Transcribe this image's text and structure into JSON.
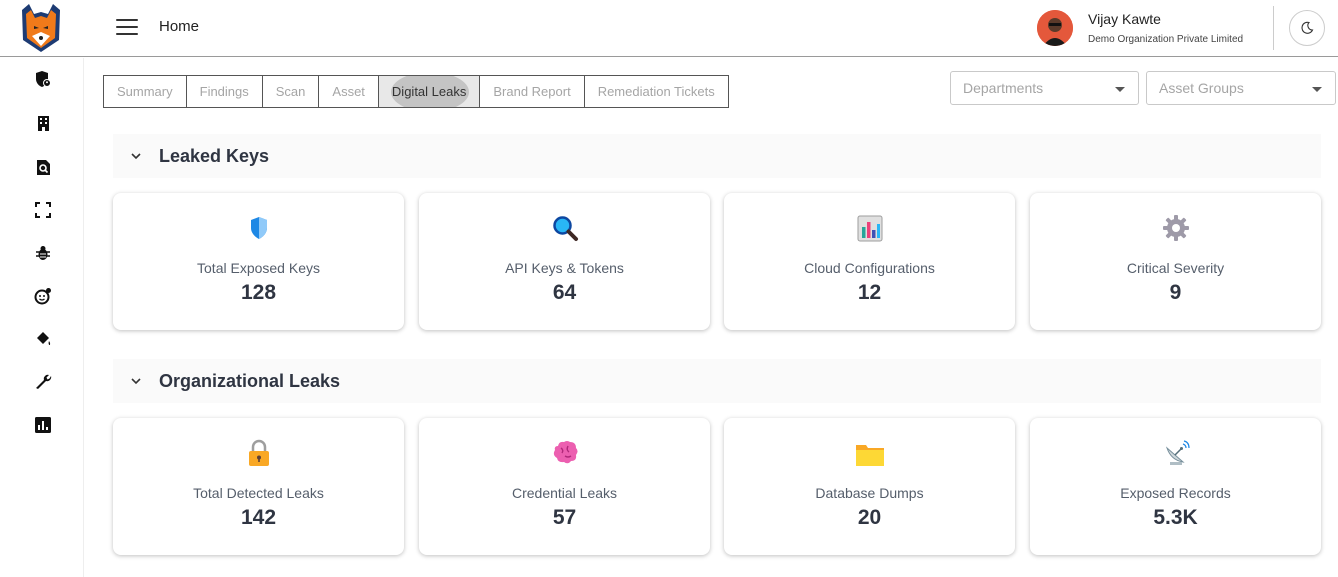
{
  "header": {
    "title": "Home",
    "user_name": "Vijay Kawte",
    "org_name": "Demo Organization Private Limited"
  },
  "tabs": [
    {
      "label": "Summary"
    },
    {
      "label": "Findings"
    },
    {
      "label": "Scan"
    },
    {
      "label": "Asset"
    },
    {
      "label": "Digital Leaks",
      "active": true
    },
    {
      "label": "Brand Report"
    },
    {
      "label": "Remediation Tickets"
    }
  ],
  "filters": {
    "departments": "Departments",
    "asset_groups": "Asset Groups"
  },
  "sidebar_icons": [
    "shield-user-icon",
    "building-icon",
    "search-document-icon",
    "fullscreen-icon",
    "bug-icon",
    "settings-face-icon",
    "paint-bucket-icon",
    "wrench-icon",
    "bar-chart-icon"
  ],
  "sections": [
    {
      "title": "Leaked Keys",
      "cards": [
        {
          "label": "Total Exposed Keys",
          "value": "128",
          "icon": "shield-icon"
        },
        {
          "label": "API Keys & Tokens",
          "value": "64",
          "icon": "magnifier-icon"
        },
        {
          "label": "Cloud Configurations",
          "value": "12",
          "icon": "bar-chart-icon"
        },
        {
          "label": "Critical Severity",
          "value": "9",
          "icon": "gear-icon"
        }
      ]
    },
    {
      "title": "Organizational Leaks",
      "cards": [
        {
          "label": "Total Detected Leaks",
          "value": "142",
          "icon": "lock-icon"
        },
        {
          "label": "Credential Leaks",
          "value": "57",
          "icon": "brain-icon"
        },
        {
          "label": "Database Dumps",
          "value": "20",
          "icon": "folder-icon"
        },
        {
          "label": "Exposed Records",
          "value": "5.3K",
          "icon": "satellite-dish-icon"
        }
      ]
    }
  ],
  "colors": {
    "accent": "#e4583b",
    "text_dark": "#2f3542",
    "text_muted": "#a5a5a5"
  }
}
